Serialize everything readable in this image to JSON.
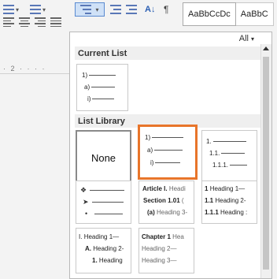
{
  "ribbon": {
    "styles": [
      "AaBbCcDc",
      "AaBbC"
    ],
    "ruler_text": "· 2 · · · ·",
    "pilcrow": "¶",
    "sort_icon": "sort-az-icon"
  },
  "gallery": {
    "filter_label": "All",
    "current_list": {
      "title": "Current List",
      "levels": [
        "1)",
        "a)",
        "i)"
      ]
    },
    "library": {
      "title": "List Library",
      "none_label": "None",
      "tile2": [
        "1)",
        "a)",
        "i)"
      ],
      "tile3": [
        "1.",
        "1.1.",
        "1.1.1."
      ],
      "tile4_bullets": [
        "❖",
        "➤",
        "•"
      ],
      "tile5": [
        {
          "num": "Article I.",
          "text": "Headi"
        },
        {
          "num": "Section 1.01",
          "text": "("
        },
        {
          "num": "(a)",
          "text": "Heading 3-"
        }
      ],
      "tile6": [
        {
          "num": "1",
          "text": "Heading 1—"
        },
        {
          "num": "1.1",
          "text": "Heading 2-"
        },
        {
          "num": "1.1.1",
          "text": "Heading :"
        }
      ],
      "tile7": [
        {
          "num": "I.",
          "text": "Heading 1—"
        },
        {
          "num": "A.",
          "text": "Heading 2-"
        },
        {
          "num": "1.",
          "text": "Heading"
        }
      ],
      "tile8": [
        {
          "num": "Chapter 1",
          "text": "Hea"
        },
        {
          "num": "",
          "text": "Heading 2—"
        },
        {
          "num": "",
          "text": "Heading 3—"
        }
      ]
    }
  },
  "colors": {
    "highlight": "#e8752a",
    "selected_button": "#cfe1f7"
  }
}
